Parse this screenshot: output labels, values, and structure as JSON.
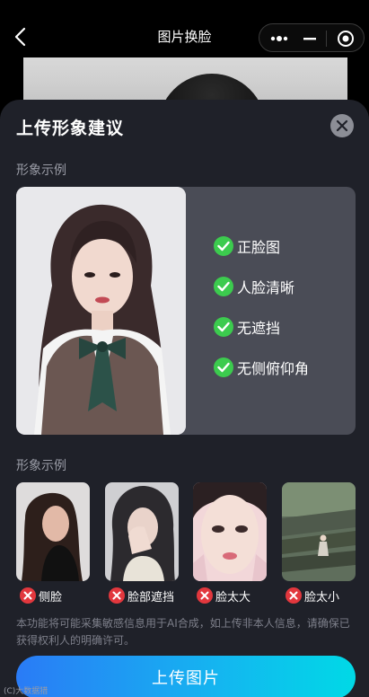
{
  "navbar": {
    "title": "图片换脸",
    "back_icon": "chevron-left-icon",
    "more_icon": "more-dots-icon",
    "minimize_icon": "minus-icon",
    "close_icon": "target-circle-icon"
  },
  "sheet": {
    "title": "上传形象建议",
    "close_icon": "close-icon",
    "example_label": "形象示例",
    "checks": [
      {
        "label": "正脸图",
        "icon": "check-icon"
      },
      {
        "label": "人脸清晰",
        "icon": "check-icon"
      },
      {
        "label": "无遮挡",
        "icon": "check-icon"
      },
      {
        "label": "无侧俯仰角",
        "icon": "check-icon"
      }
    ],
    "bad_example_label": "形象示例",
    "bad_examples": [
      {
        "label": "侧脸",
        "icon": "cross-icon"
      },
      {
        "label": "脸部遮挡",
        "icon": "cross-icon"
      },
      {
        "label": "脸太大",
        "icon": "cross-icon"
      },
      {
        "label": "脸太小",
        "icon": "cross-icon"
      }
    ],
    "disclaimer": "本功能将可能采集敏感信息用于AI合成，如上传非本人信息，请确保已获得权利人的明确许可。",
    "upload_button": "上传图片"
  },
  "colors": {
    "sheet_bg": "#1f2129",
    "card_bg": "#4a4c56",
    "check_green": "#3ccb4e",
    "cross_red": "#e2373d",
    "button_gradient_start": "#2a7bf6",
    "button_gradient_end": "#00d9e6"
  },
  "watermark": "(C)大数据猎"
}
